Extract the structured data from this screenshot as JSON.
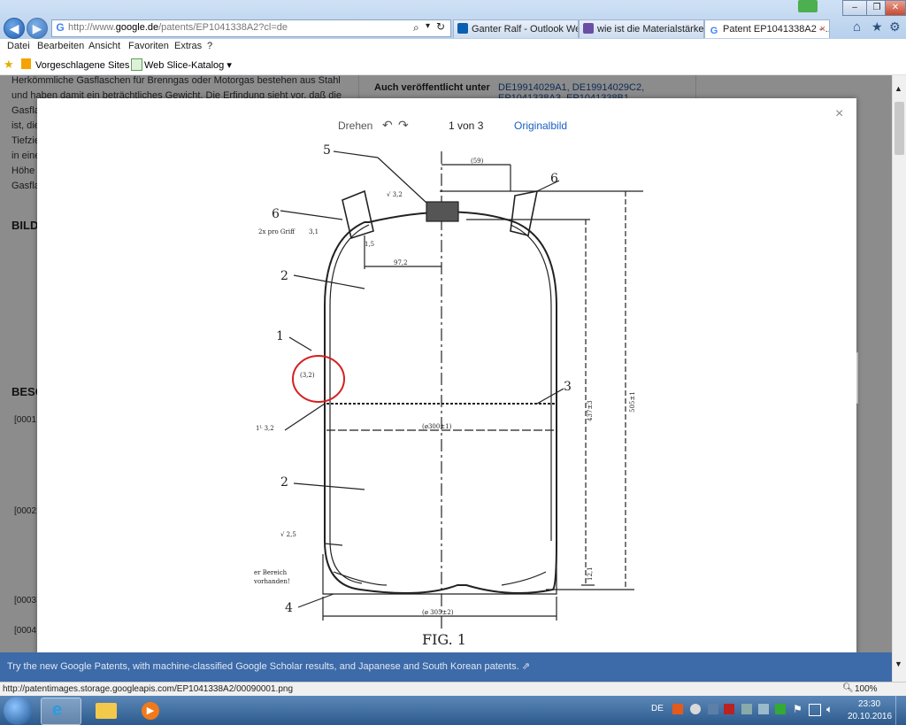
{
  "browser": {
    "address_url_prefix": "http://www.",
    "address_url_domain": "google.de",
    "address_url_suffix": "/patents/EP1041338A2?cl=de",
    "tabs": [
      {
        "label": "Ganter Ralf - Outlook Web...",
        "icon_color": "#0b5fb0"
      },
      {
        "label": "wie ist die Materialstärke v...",
        "icon_color": "#6b4fa5"
      },
      {
        "label": "Patent EP1041338A2 - ...",
        "icon_color": "#4285f4"
      }
    ],
    "menu": [
      "Datei",
      "Bearbeiten",
      "Ansicht",
      "Favoriten",
      "Extras",
      "?"
    ],
    "favorites": [
      {
        "label": "Vorgeschlagene Sites ▾"
      },
      {
        "label": "Web Slice-Katalog ▾"
      }
    ]
  },
  "page": {
    "background_lines": [
      "Herkömmliche Gasflaschen für Brenngas oder Motorgas bestehen aus Stahl",
      "und haben damit ein beträchtliches Gewicht. Die Erfindung sieht vor, daß die",
      "Gasfla",
      "ist, die",
      "Tiefzie",
      "in eine",
      "Höhe",
      "Gasfla"
    ],
    "also_published_label": "Auch veröffentlicht unter",
    "also_published_values": "DE19914029A1, DE19914029C2,",
    "also_published_values_2": "EP1041338A3, EP1041338B1",
    "section_bild": "BILD",
    "section_besc": "BESC",
    "paragraphs": [
      "[0001",
      "[0002",
      "[0003",
      "[0004"
    ]
  },
  "modal": {
    "rotate_label": "Drehen",
    "page_counter": "1 von 3",
    "original_label": "Originalbild",
    "close_symbol": "×",
    "prev_symbol": "‹",
    "next_symbol": "›",
    "drawing_labels": {
      "l5": "5",
      "l6a": "6",
      "l6b": "6",
      "l2a": "2",
      "l2b": "2",
      "l1": "1",
      "l3": "3",
      "l4": "4",
      "d59": "(59)",
      "r32": "√ 3,2",
      "grip": "2x pro Griff",
      "t31": "3,1",
      "t15": "1,5",
      "d97": "97,2",
      "wall": "(3,2)",
      "tl32": "1ᴸ 3,2",
      "dia300": "(ø300±1)",
      "r25": "√ 2,5",
      "bereich1": "er Bereich",
      "bereich2": "vorhanden!",
      "h12": "12,1",
      "dia305": "(ø 305±2)",
      "h437": "437±3",
      "h505": "505±1",
      "fig": "FIG. 1"
    }
  },
  "banner": {
    "text": "Try the new Google Patents, with machine-classified Google Scholar results, and Japanese and South Korean patents. ⇗"
  },
  "status": {
    "url": "http://patentimages.storage.googleapis.com/EP1041338A2/00090001.png",
    "zoom": "100%"
  },
  "taskbar": {
    "lang": "DE",
    "time": "23:30",
    "date": "20.10.2016"
  }
}
